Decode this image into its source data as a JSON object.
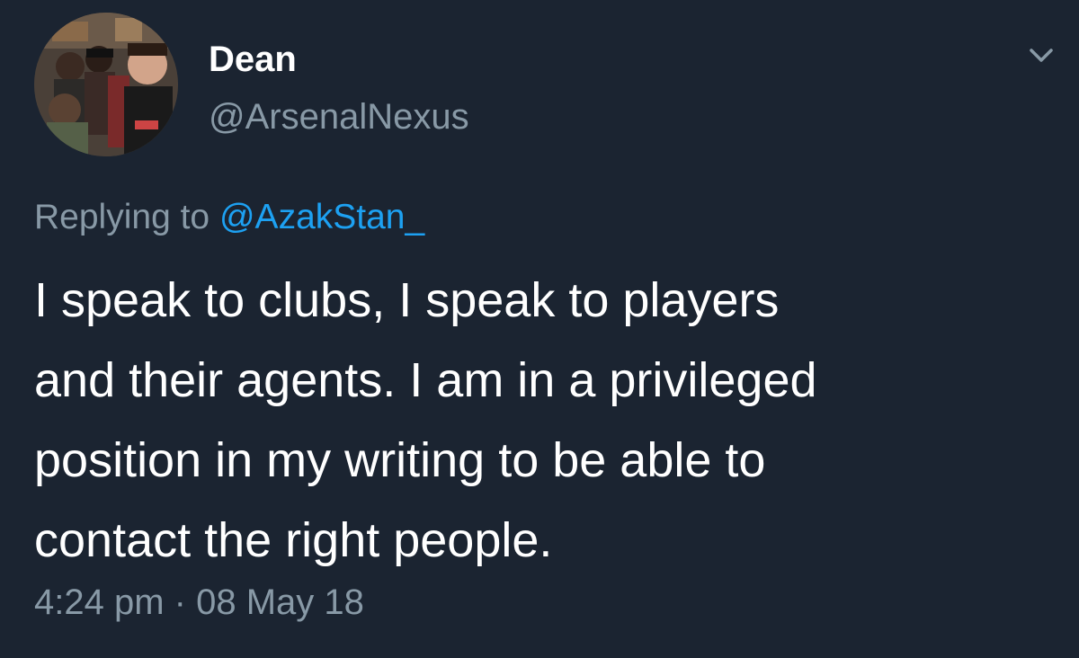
{
  "tweet": {
    "author": {
      "display_name": "Dean",
      "handle": "@ArsenalNexus"
    },
    "reply": {
      "prefix": "Replying to",
      "mention": "@AzakStan_"
    },
    "body_lines": [
      "I speak to clubs, I speak to players",
      "and their agents. I am in a privileged",
      "position in my writing to be able to",
      "contact the right people."
    ],
    "timestamp": {
      "time": "4:24 pm",
      "separator": "·",
      "date": "08 May 18"
    },
    "icons": {
      "menu": "chevron-down-icon"
    }
  },
  "colors": {
    "background": "#1b2431",
    "primary_text": "#ffffff",
    "secondary_text": "#8899a6",
    "mention": "#1da1f2"
  }
}
